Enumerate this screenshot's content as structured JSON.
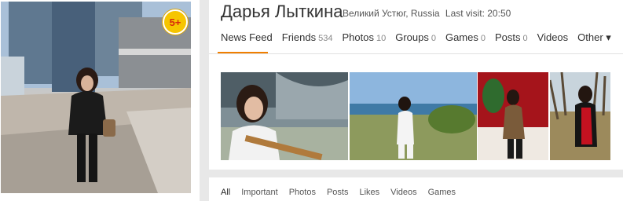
{
  "profile": {
    "badge": "5+",
    "name": "Дарья Лыткина",
    "location": "Великий Устюг, Russia",
    "last_visit": "Last visit: 20:50"
  },
  "tabs": [
    {
      "label": "News Feed",
      "count": ""
    },
    {
      "label": "Friends",
      "count": "534"
    },
    {
      "label": "Photos",
      "count": "10"
    },
    {
      "label": "Groups",
      "count": "0"
    },
    {
      "label": "Games",
      "count": "0"
    },
    {
      "label": "Posts",
      "count": "0"
    },
    {
      "label": "Videos",
      "count": ""
    },
    {
      "label": "Other ▾",
      "count": ""
    }
  ],
  "feed_filters": [
    "All",
    "Important",
    "Photos",
    "Posts",
    "Likes",
    "Videos",
    "Games"
  ],
  "colors": {
    "accent": "#f07f00",
    "badge_bg": "#f6c500",
    "badge_text": "#d62a0c"
  }
}
